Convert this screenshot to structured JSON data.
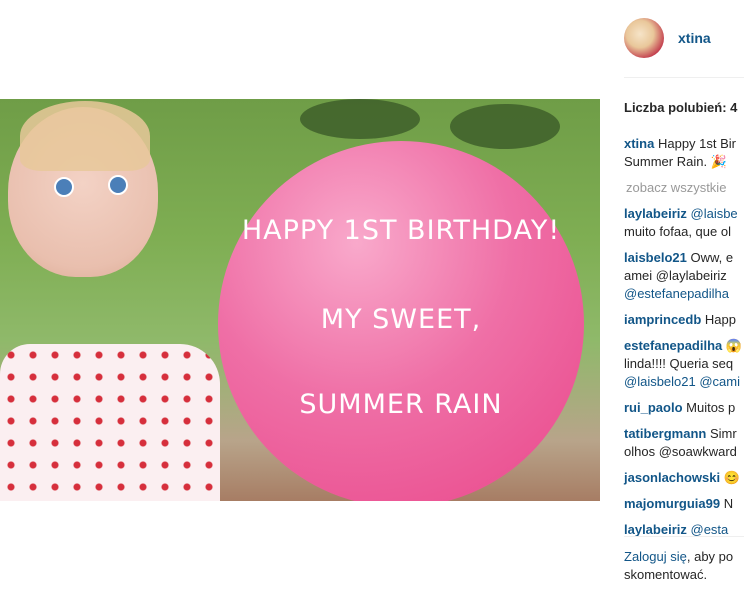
{
  "post": {
    "balloon_lines": [
      "HAPPY 1ST BIRTHDAY!",
      "MY SWEET,",
      "SUMMER RAIN"
    ]
  },
  "author": {
    "username": "xtina"
  },
  "likes": {
    "label": "Liczba polubień: 4"
  },
  "caption": {
    "user": "xtina",
    "text": "Happy 1st Bir",
    "text_line2": "Summer Rain. 🎉"
  },
  "view_all": "zobacz wszystkie",
  "comments": [
    {
      "user": "laylabeiriz",
      "text": "@laisbe",
      "line2": "muito fofaa, que ol"
    },
    {
      "user": "laisbelo21",
      "text": "Oww, e",
      "line2": "amei @laylabeiriz",
      "line3": "@estefanepadilha"
    },
    {
      "user": "iamprincedb",
      "text": "Happ"
    },
    {
      "user": "estefanepadilha",
      "text": "😱",
      "line2": "linda!!!! Queria seq",
      "line3": "@laisbelo21 @cami"
    },
    {
      "user": "rui_paolo",
      "text": "Muitos p"
    },
    {
      "user": "tatibergmann",
      "text": "Simr",
      "line2": "olhos @soawkward"
    },
    {
      "user": "jasonlachowski",
      "text": "😊"
    },
    {
      "user": "majomurguia99",
      "text": "N"
    },
    {
      "user": "laylabeiriz",
      "text": "@esta"
    }
  ],
  "login_prompt": {
    "link": "Zaloguj się",
    "text": ", aby po",
    "line2": "skomentować."
  }
}
